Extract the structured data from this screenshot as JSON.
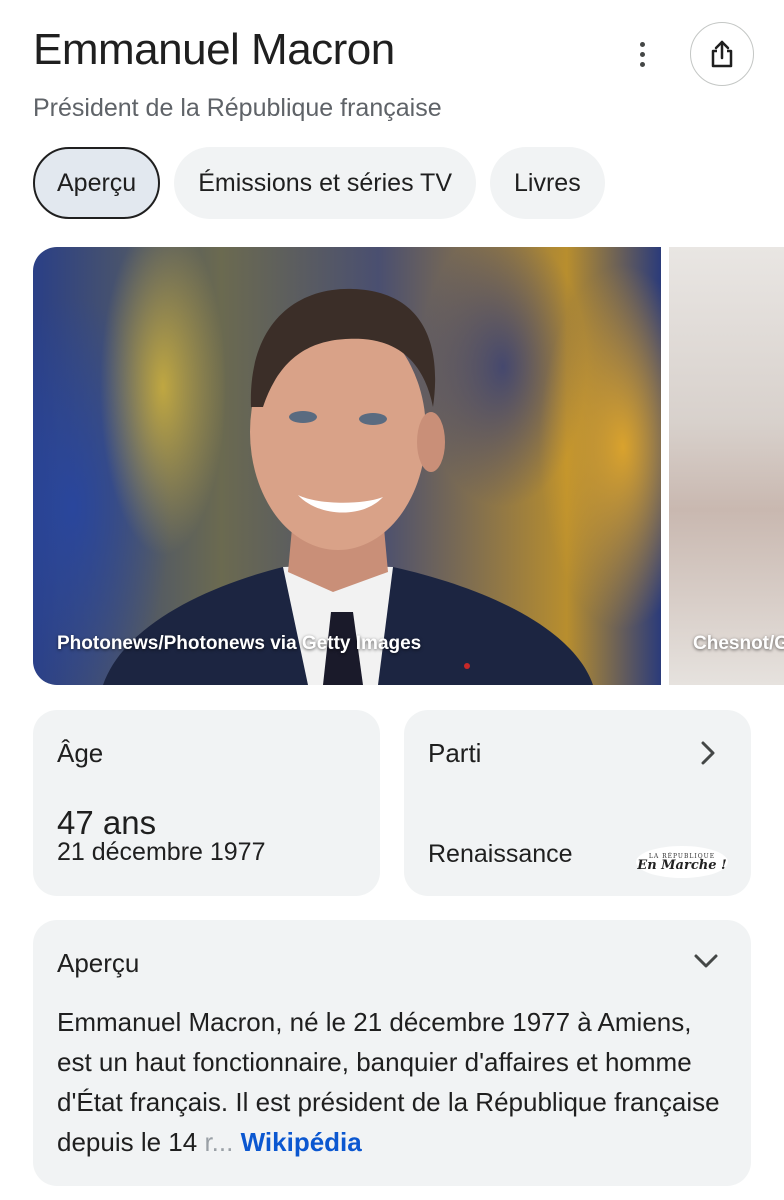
{
  "header": {
    "title": "Emmanuel Macron",
    "subtitle": "Président de la République française",
    "more_icon": "more-vert-icon",
    "share_icon": "share-icon"
  },
  "tabs": [
    {
      "label": "Aperçu",
      "active": true
    },
    {
      "label": "Émissions et séries TV",
      "active": false
    },
    {
      "label": "Livres",
      "active": false
    }
  ],
  "images": [
    {
      "caption": "Photonews/Photonews via Getty Images"
    },
    {
      "caption": "Chesnot/G"
    }
  ],
  "age_card": {
    "label": "Âge",
    "value": "47 ans",
    "date": "21 décembre 1977"
  },
  "party_card": {
    "label": "Parti",
    "value": "Renaissance",
    "logo_small": "LA RÉPUBLIQUE",
    "logo_big": "En Marche !"
  },
  "overview": {
    "title": "Aperçu",
    "text": "Emmanuel Macron, né le 21 décembre 1977 à Amiens, est un haut fonctionnaire, banquier d'affaires et homme d'État français. Il est président de la République française depuis le 14",
    "fade": " r...",
    "link": "Wikipédia"
  },
  "colors": {
    "link": "#0b57d0",
    "card_bg": "#f1f3f4",
    "active_tab_bg": "#e2e8ef"
  }
}
